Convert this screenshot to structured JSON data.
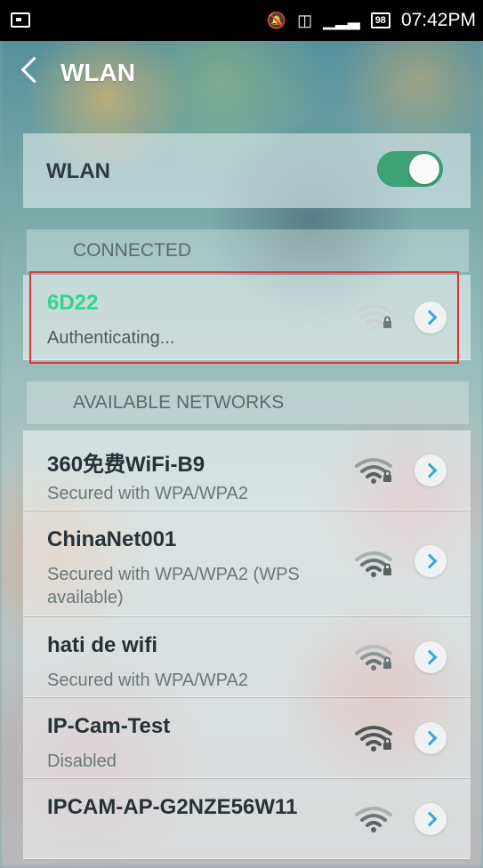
{
  "status_bar": {
    "icons": [
      "screenshot-icon",
      "mute-icon",
      "sim-disabled-icon",
      "signal-icon"
    ],
    "battery": "98",
    "time": "07:42PM"
  },
  "header": {
    "back_icon": "chevron-left-icon",
    "title": "WLAN"
  },
  "wlan": {
    "label": "WLAN",
    "enabled": true,
    "accent_color": "#3fa37a"
  },
  "sections": {
    "connected": "CONNECTED",
    "available": "AVAILABLE NETWORKS"
  },
  "connected_network": {
    "name": "6D22",
    "status": "Authenticating...",
    "name_color": "#2bd68f",
    "icon": "wifi-lock-icon"
  },
  "networks": [
    {
      "name": "360免费WiFi-B9",
      "status": "Secured with WPA/WPA2",
      "icon": "wifi-lock-icon"
    },
    {
      "name": "ChinaNet001",
      "status": "Secured with WPA/WPA2 (WPS available)",
      "icon": "wifi-lock-icon"
    },
    {
      "name": "hati de wifi",
      "status": "Secured with WPA/WPA2",
      "icon": "wifi-lock-icon"
    },
    {
      "name": "IP-Cam-Test",
      "status": "Disabled",
      "icon": "wifi-lock-icon"
    },
    {
      "name": "IPCAM-AP-G2NZE56W11",
      "status": "",
      "icon": "wifi-icon"
    }
  ]
}
